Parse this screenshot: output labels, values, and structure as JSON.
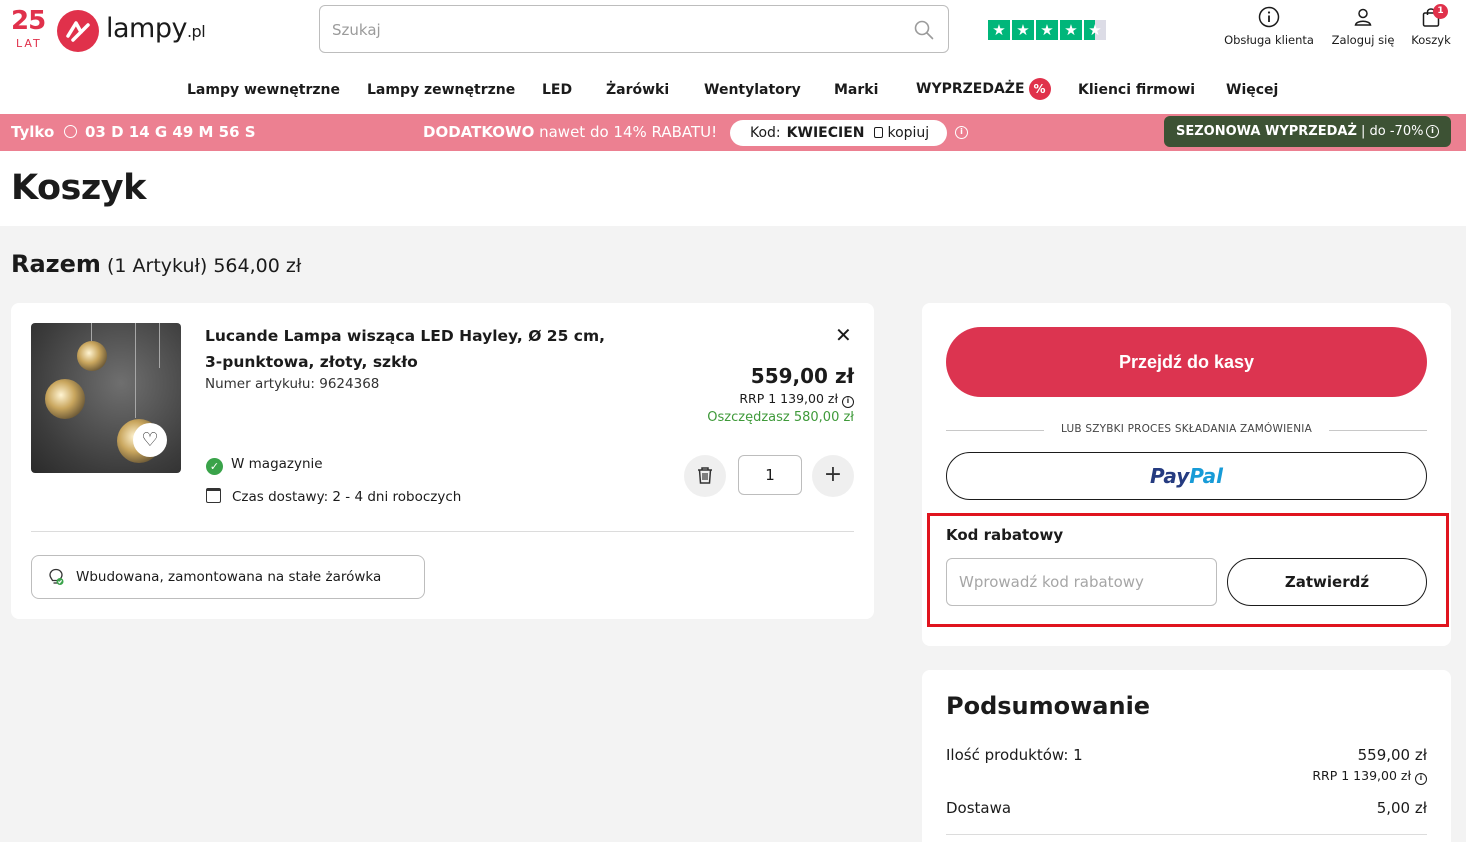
{
  "header": {
    "logo_years": "25",
    "logo_lat": "LAT",
    "logo_brand": "lampy",
    "logo_tld": ".pl",
    "search_placeholder": "Szukaj",
    "customer_service": "Obsługa klienta",
    "login": "Zaloguj się",
    "cart": "Koszyk",
    "cart_count": "1",
    "rating_stars": 4.5
  },
  "nav": {
    "items": [
      "Lampy wewnętrzne",
      "Lampy zewnętrzne",
      "LED",
      "Żarówki",
      "Wentylatory",
      "Marki",
      "WYPRZEDAŻE",
      "Klienci firmowi",
      "Więcej"
    ],
    "sale_badge": "%"
  },
  "promo": {
    "only": "Tylko",
    "timer": "03 D 14 G 49 M 56 S",
    "extra_bold": "DODATKOWO",
    "extra_rest": " nawet do 14% RABATU!",
    "code_label": "Kod:",
    "code_value": "KWIECIEN",
    "copy_label": "kopiuj",
    "sale_bold": "SEZONOWA WYPRZEDAŻ",
    "sale_rest": " | do -70%",
    "info_glyph": "i"
  },
  "page": {
    "title": "Koszyk",
    "total_label": "Razem",
    "total_count": " (1 Artykuł) ",
    "total_value": "564,00 zł"
  },
  "item": {
    "name": "Lucande Lampa wisząca LED Hayley, Ø 25 cm, 3-punktowa, złoty, szkło",
    "number": "Numer artykułu: 9624368",
    "price": "559,00 zł",
    "rrp": "RRP 1 139,00 zł",
    "savings": "Oszczędzasz 580,00 zł",
    "stock": "W magazynie",
    "delivery": "Czas dostawy: 2 - 4 dni roboczych",
    "quantity": "1",
    "plus": "+",
    "close": "✕",
    "heart": "♡",
    "check": "✓",
    "feature": "Wbudowana, zamontowana na stałe żarówka"
  },
  "checkout": {
    "button": "Przejdź do kasy",
    "or_text": "LUB SZYBKI PROCES SKŁADANIA ZAMÓWIENIA",
    "paypal_1": "Pay",
    "paypal_2": "Pal",
    "coupon_label": "Kod rabatowy",
    "coupon_placeholder": "Wprowadź kod rabatowy",
    "coupon_submit": "Zatwierdź"
  },
  "summary": {
    "title": "Podsumowanie",
    "products_label": "Ilość produktów: 1",
    "products_value": "559,00 zł",
    "products_rrp": "RRP 1 139,00 zł",
    "shipping_label": "Dostawa",
    "shipping_value": "5,00 zł"
  },
  "colors": {
    "brand": "#e0314b",
    "promo_bg": "#ec8091",
    "sale_pill": "#3d5234",
    "checkout": "#dc3450",
    "highlight": "#e0141e",
    "savings": "#3f9a3a",
    "trustpilot": "#00b67a"
  }
}
